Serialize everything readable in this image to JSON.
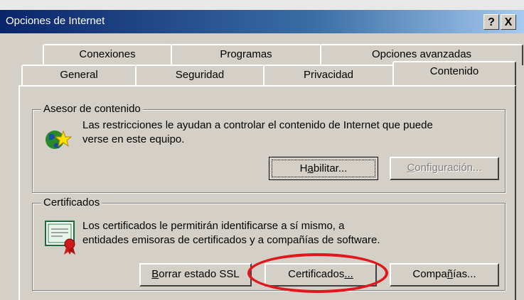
{
  "window": {
    "title": "Opciones de Internet",
    "help_label": "?",
    "close_label": "X"
  },
  "tabs_back": [
    "Conexiones",
    "Programas",
    "Opciones avanzadas"
  ],
  "tabs_front": [
    "General",
    "Seguridad",
    "Privacidad",
    "Contenido"
  ],
  "active_tab": "Contenido",
  "content_advisor": {
    "legend": "Asesor de contenido",
    "line1": "Las restricciones le ayudan a controlar el contenido de Internet que puede",
    "line2": "verse en este equipo.",
    "enable_pre": "H",
    "enable_key": "a",
    "enable_post": "bilitar...",
    "settings_pre": "",
    "settings_key": "C",
    "settings_post": "onfiguración..."
  },
  "certificates": {
    "legend": "Certificados",
    "line1": "Los certificados le permitirán identificarse a sí mismo, a",
    "line2": "entidades emisoras de certificados y a compañías de software.",
    "clear_ssl_key": "B",
    "clear_ssl_post": "orrar estado SSL",
    "certs_pre": "Certificados",
    "certs_key": "...",
    "publishers_pre": "Compa",
    "publishers_key": "ñ",
    "publishers_post": "ías..."
  },
  "annotation_color": "#e0171d"
}
